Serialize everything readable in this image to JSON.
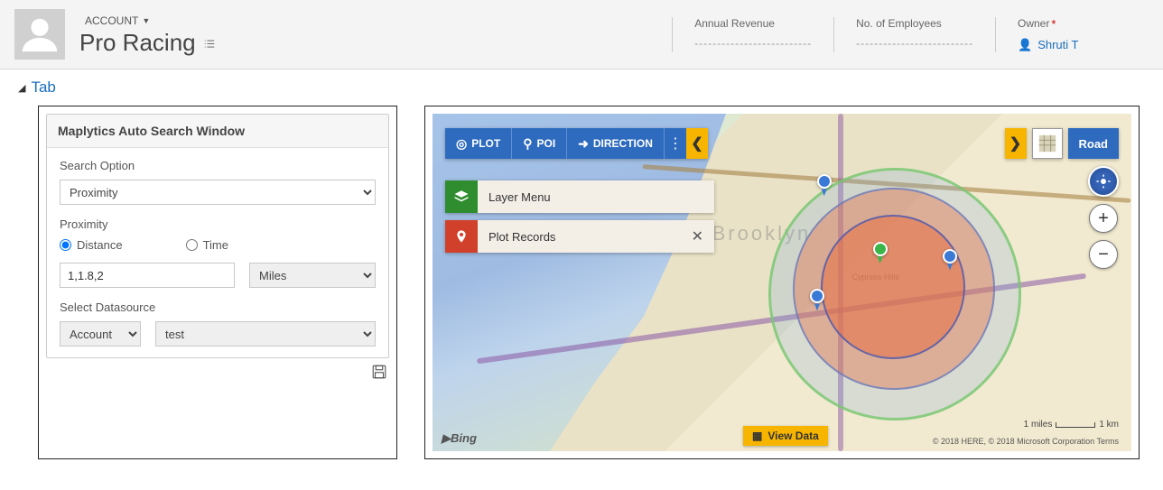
{
  "header": {
    "account_label": "ACCOUNT",
    "entity_name": "Pro Racing",
    "annual_revenue_label": "Annual Revenue",
    "annual_revenue_value": "--------------------------",
    "employees_label": "No. of Employees",
    "employees_value": "--------------------------",
    "owner_label": "Owner",
    "owner_name": "Shruti T"
  },
  "tab": {
    "label": "Tab"
  },
  "search_panel": {
    "title": "Maplytics Auto Search Window",
    "search_option_label": "Search Option",
    "search_option_value": "Proximity",
    "proximity_label": "Proximity",
    "radio_distance": "Distance",
    "radio_time": "Time",
    "radio_selected": "distance",
    "distance_value": "1,1.8,2",
    "unit_value": "Miles",
    "datasource_label": "Select Datasource",
    "datasource_value": "Account",
    "datasource2_value": "test"
  },
  "map": {
    "toolbar": {
      "plot": "PLOT",
      "poi": "POI",
      "direction": "DIRECTION"
    },
    "layer_menu": "Layer Menu",
    "plot_records": "Plot Records",
    "view_type": "Road",
    "view_data": "View Data",
    "scale_miles": "1 miles",
    "scale_km": "1 km",
    "attribution": "© 2018 HERE, © 2018 Microsoft Corporation   Terms",
    "bing": "Bing",
    "labels": {
      "brooklyn": "Brooklyn",
      "cypress": "Cypress Hills"
    }
  }
}
